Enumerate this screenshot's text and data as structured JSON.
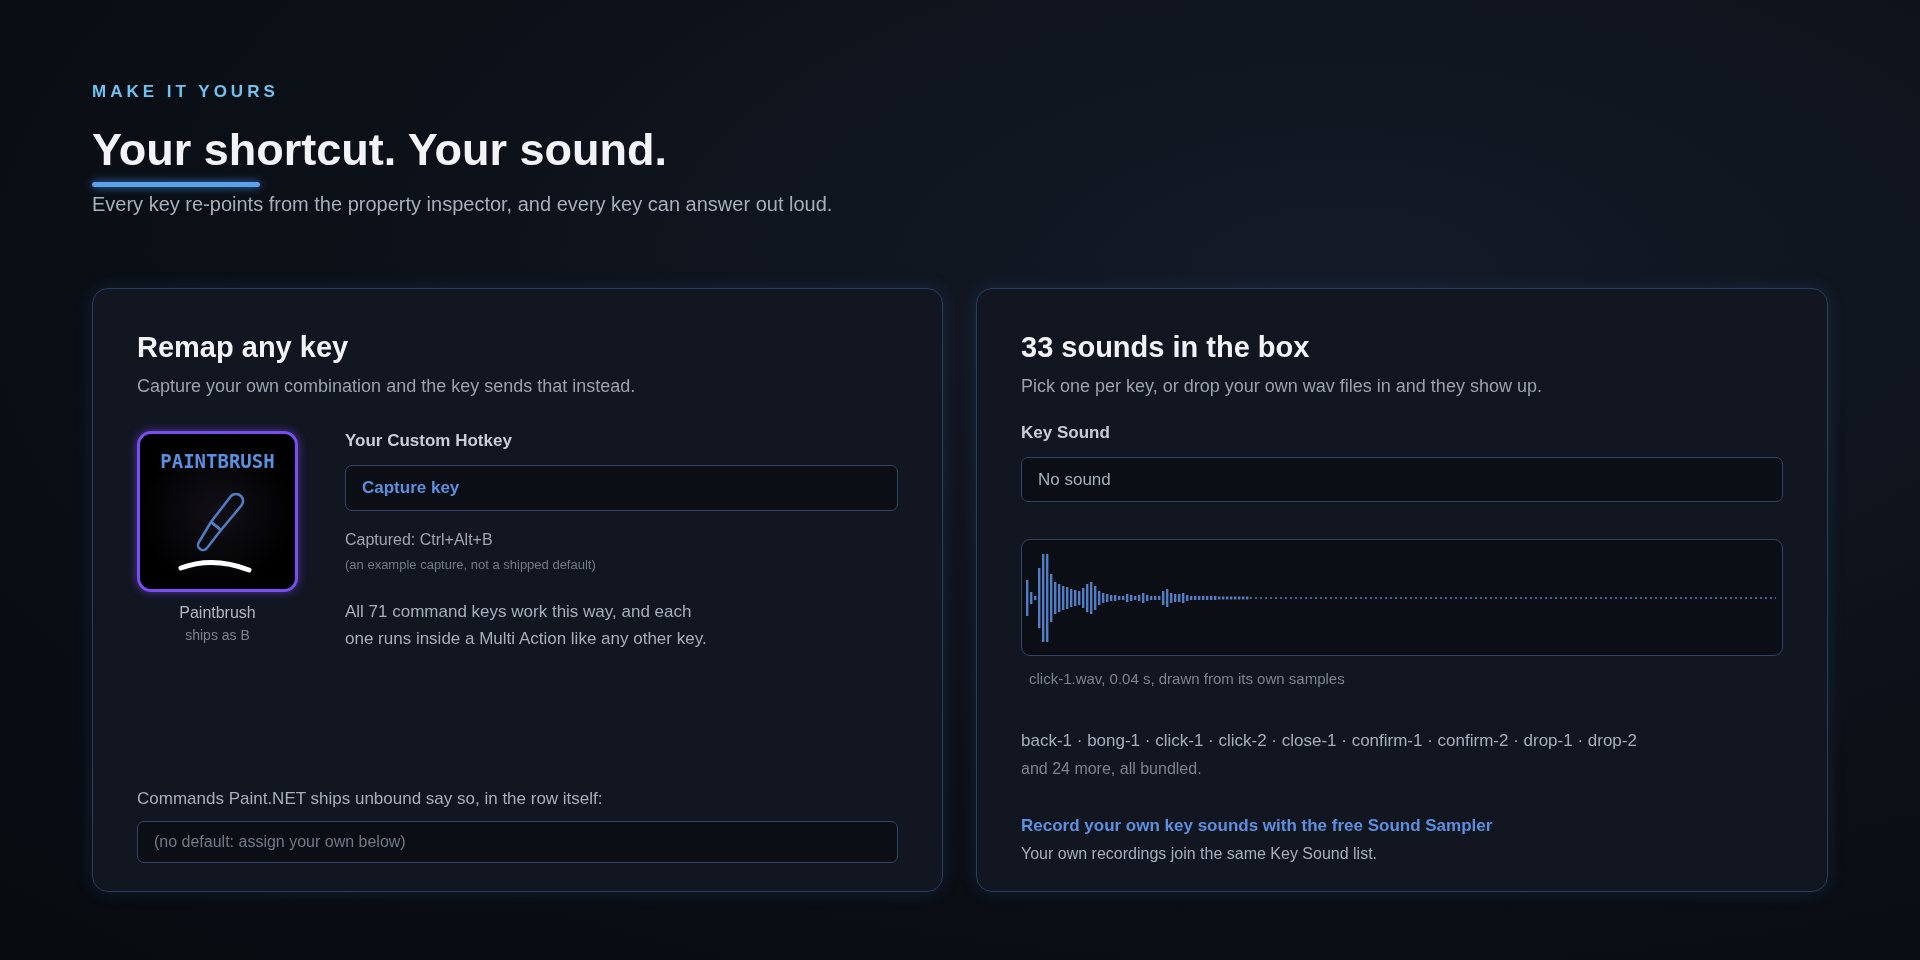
{
  "eyebrow": "MAKE IT YOURS",
  "heading": "Your shortcut. Your sound.",
  "intro": "Every key re-points from the property inspector, and every key can answer out loud.",
  "remap": {
    "title": "Remap any key",
    "subtitle": "Capture your own combination and the key sends that instead.",
    "key_tile": {
      "label": "PAINTBRUSH",
      "name": "Paintbrush",
      "default": "ships as B"
    },
    "hotkey": {
      "label": "Your Custom Hotkey",
      "button": "Capture key",
      "captured": "Captured: Ctrl+Alt+B",
      "note": "(an example capture, not a shipped default)"
    },
    "body": "All 71 command keys work this way, and each one runs inside a Multi Action like any other key.",
    "unbound": {
      "label": "Commands Paint.NET ships unbound say so, in the row itself:",
      "placeholder": "(no default: assign your own below)"
    }
  },
  "sounds": {
    "title": "33 sounds in the box",
    "subtitle": "Pick one per key, or drop your own wav files in and they show up.",
    "key_sound": {
      "label": "Key Sound",
      "value": "No sound"
    },
    "waveform": {
      "caption": "click-1.wav, 0.04 s, drawn from its own samples"
    },
    "sound_list": "back-1 · bong-1 · click-1 · click-2 · close-1 · confirm-1 · confirm-2 · drop-1 · drop-2",
    "more": "and 24 more, all bundled.",
    "link": "Record your own key sounds with the free Sound Sampler",
    "link_note": "Your own recordings join the same Key Sound list."
  }
}
